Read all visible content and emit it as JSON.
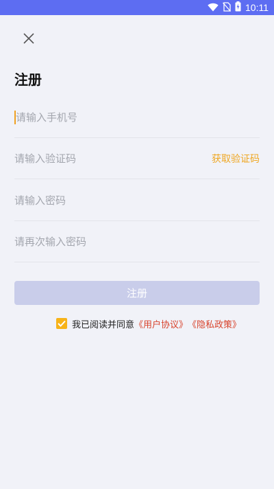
{
  "status_bar": {
    "time": "10:11",
    "icons": [
      "wifi-icon",
      "no-sim-icon",
      "battery-charging-icon"
    ],
    "bg_color": "#5d6df2"
  },
  "page": {
    "title": "注册",
    "close_icon": "close-icon"
  },
  "form": {
    "phone_placeholder": "请输入手机号",
    "code_placeholder": "请输入验证码",
    "get_code_label": "获取验证码",
    "password_placeholder": "请输入密码",
    "confirm_password_placeholder": "请再次输入密码",
    "submit_label": "注册"
  },
  "agreement": {
    "checked": true,
    "prefix": "我已阅读并同意",
    "user_agreement": "《用户协议》",
    "privacy_policy": "《隐私政策》"
  },
  "colors": {
    "accent": "#efa722",
    "link": "#d8432c",
    "button_disabled": "#c9cdea",
    "background": "#f1f2f8"
  }
}
